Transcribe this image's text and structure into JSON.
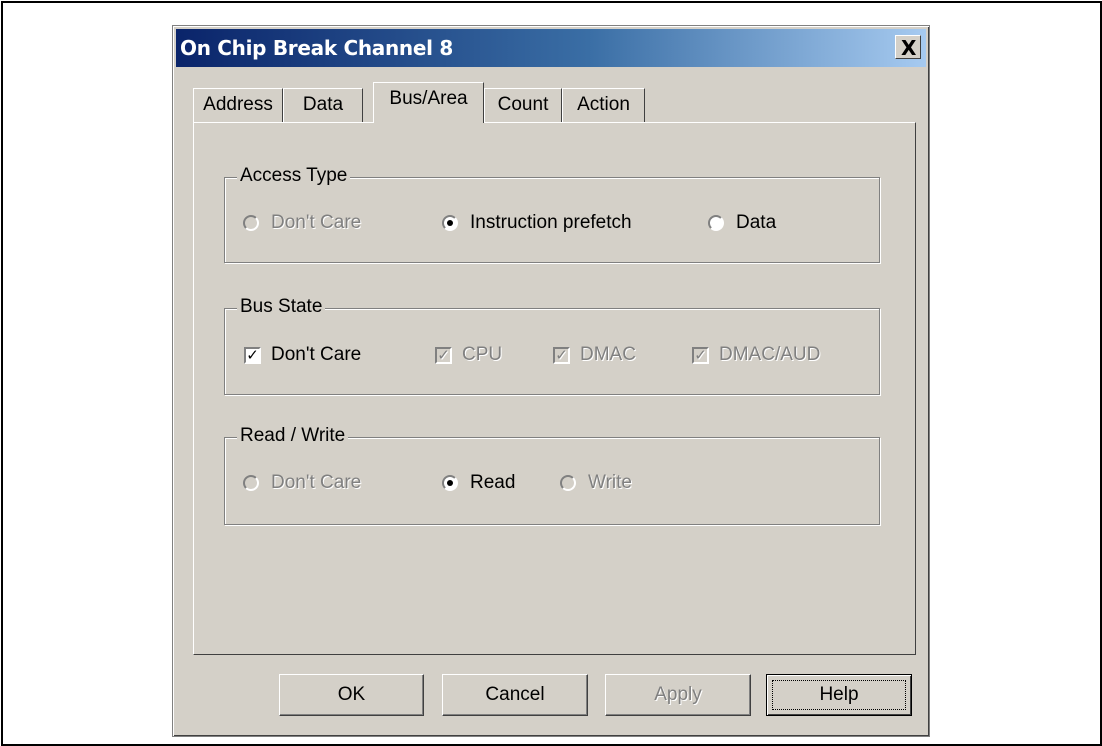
{
  "dialog": {
    "title": "On Chip Break Channel 8",
    "close_label": "X"
  },
  "tabs": [
    {
      "label": "Address"
    },
    {
      "label": "Data"
    },
    {
      "label": "Bus/Area"
    },
    {
      "label": "Count"
    },
    {
      "label": "Action"
    }
  ],
  "active_tab": "Bus/Area",
  "access_type": {
    "label": "Access Type",
    "options": [
      {
        "label": "Don't Care",
        "selected": false,
        "enabled": false
      },
      {
        "label": "Instruction prefetch",
        "selected": true,
        "enabled": true
      },
      {
        "label": "Data",
        "selected": false,
        "enabled": true
      }
    ]
  },
  "bus_state": {
    "label": "Bus State",
    "options": [
      {
        "label": "Don't Care",
        "checked": true,
        "enabled": true
      },
      {
        "label": "CPU",
        "checked": true,
        "enabled": false
      },
      {
        "label": "DMAC",
        "checked": true,
        "enabled": false
      },
      {
        "label": "DMAC/AUD",
        "checked": true,
        "enabled": false
      }
    ]
  },
  "read_write": {
    "label": "Read / Write",
    "options": [
      {
        "label": "Don't Care",
        "selected": false,
        "enabled": false
      },
      {
        "label": "Read",
        "selected": true,
        "enabled": true
      },
      {
        "label": "Write",
        "selected": false,
        "enabled": false
      }
    ]
  },
  "buttons": {
    "ok": "OK",
    "cancel": "Cancel",
    "apply": "Apply",
    "help": "Help"
  },
  "check_mark": "✓"
}
